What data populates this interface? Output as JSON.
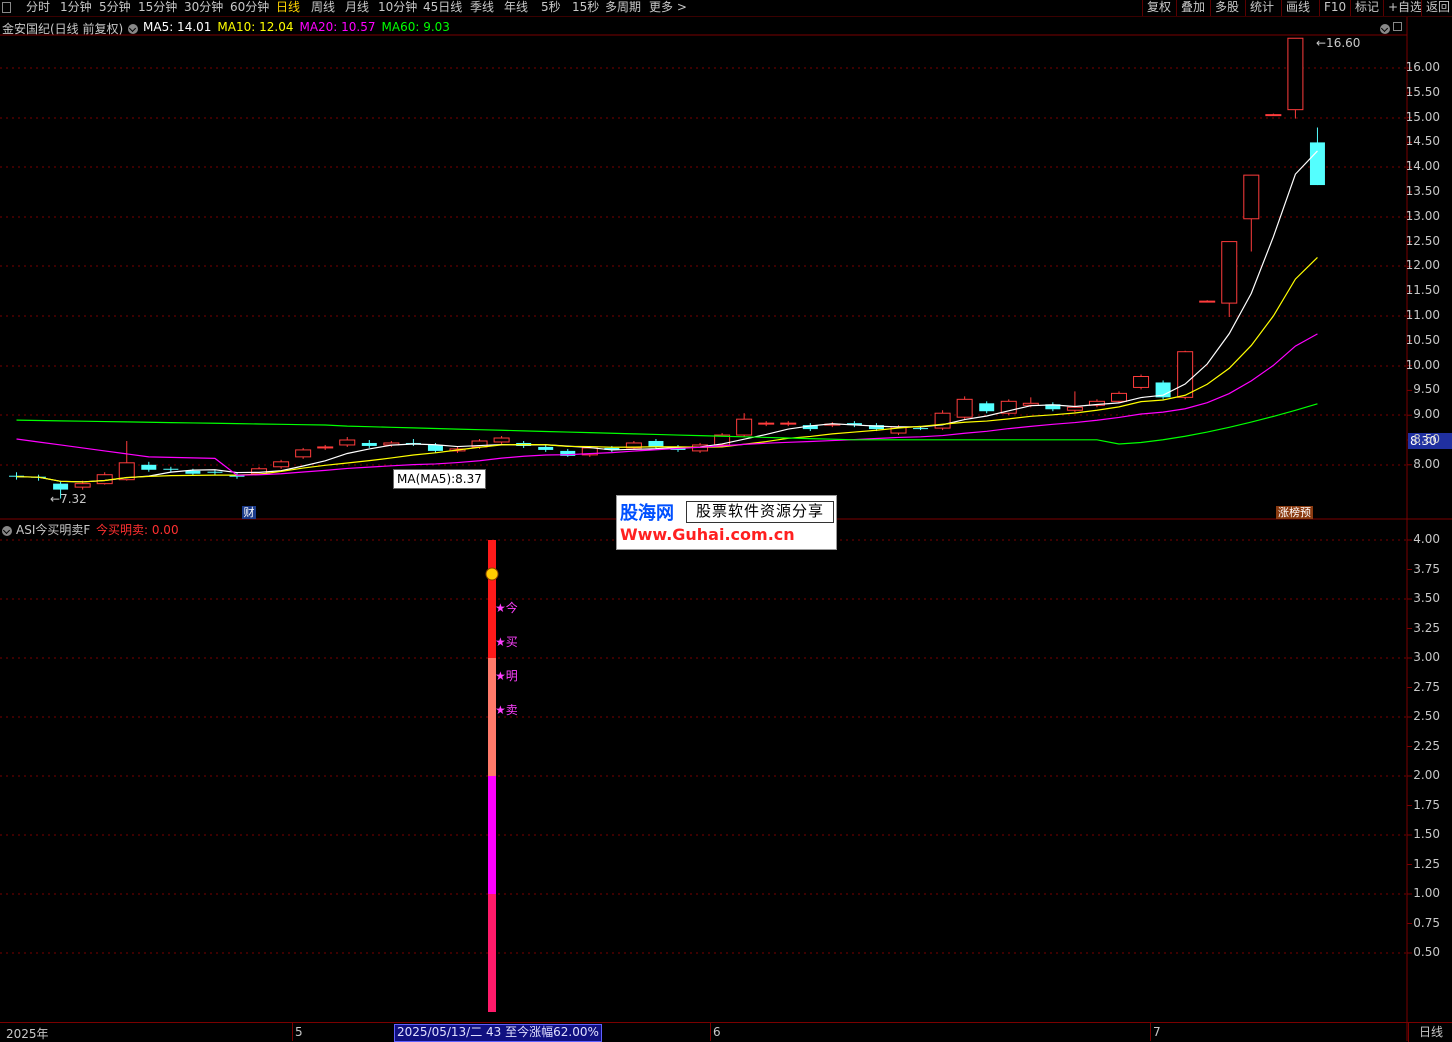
{
  "toolbar": {
    "periods": [
      "分时",
      "1分钟",
      "5分钟",
      "15分钟",
      "30分钟",
      "60分钟",
      "日线",
      "周线",
      "月线",
      "10分钟",
      "45日线",
      "季线",
      "年线",
      "5秒",
      "15秒",
      "多周期",
      "更多 >"
    ],
    "active_period": "日线",
    "right_buttons": [
      "复权",
      "叠加",
      "多股",
      "统计",
      "画线",
      "F10",
      "标记",
      "+自选",
      "返回"
    ]
  },
  "main_chart": {
    "stock_title": "金安国纪(日线 前复权)",
    "ma_legend": [
      {
        "label": "MA5: 14.01",
        "color": "#ffffff"
      },
      {
        "label": "MA10: 12.04",
        "color": "#ffff00"
      },
      {
        "label": "MA20: 10.57",
        "color": "#ff00ff"
      },
      {
        "label": "MA60: 9.03",
        "color": "#00ff00"
      }
    ],
    "high_label": "16.60",
    "low_label": "7.32",
    "tooltip": "MA(MA5):8.37",
    "current_price_tag": "8.30",
    "fin_marker": "财",
    "limit_up_marker": "涨榜预",
    "price_axis": [
      "16.00",
      "15.50",
      "15.00",
      "14.50",
      "14.00",
      "13.50",
      "13.00",
      "12.50",
      "12.00",
      "11.50",
      "11.00",
      "10.50",
      "10.00",
      "9.50",
      "9.00",
      "8.50",
      "8.00"
    ]
  },
  "sub_chart": {
    "indicator_name": "ASI今买明卖F",
    "indicator_value": "今买明卖: 0.00",
    "value_axis": [
      "4.00",
      "3.75",
      "3.50",
      "3.25",
      "3.00",
      "2.75",
      "2.50",
      "2.25",
      "2.00",
      "1.75",
      "1.50",
      "1.25",
      "1.00",
      "0.75",
      "0.50"
    ],
    "signal_chars": [
      "★今",
      "★买",
      "★明",
      "★卖"
    ]
  },
  "watermark": {
    "brand": "股海网",
    "slogan": "股票软件资源分享",
    "url": "Www.Guhai.com.cn"
  },
  "bottom_axis": {
    "labels": [
      "2025年",
      "5",
      "6",
      "7"
    ],
    "cursor_info": "2025/05/13/二 43 至今涨幅62.00%",
    "period_button": "日线"
  },
  "colors": {
    "up": "#ff3c3c",
    "down": "#54ffff",
    "grid": "#7a0000",
    "ma5": "#ffffff",
    "ma10": "#ffff00",
    "ma20": "#ff00ff",
    "ma60": "#00ff00"
  }
}
